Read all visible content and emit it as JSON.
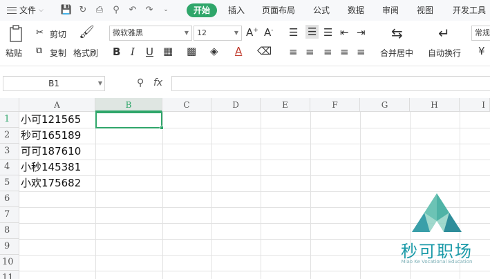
{
  "menubar": {
    "file_label": "文件",
    "tabs": [
      {
        "label": "开始",
        "active": true
      },
      {
        "label": "插入"
      },
      {
        "label": "页面布局"
      },
      {
        "label": "公式"
      },
      {
        "label": "数据"
      },
      {
        "label": "审阅"
      },
      {
        "label": "视图"
      },
      {
        "label": "开发工具"
      }
    ]
  },
  "ribbon": {
    "paste": "粘贴",
    "cut": "剪切",
    "copy": "复制",
    "format_painter": "格式刷",
    "font_name": "微软雅黑",
    "font_size": "12",
    "bold": "B",
    "italic": "I",
    "underline": "U",
    "merge_center": "合并居中",
    "wrap_text": "自动换行",
    "number_format": "常规",
    "currency": "¥"
  },
  "formulabar": {
    "cell_ref": "B1",
    "fx": "fx"
  },
  "sheet": {
    "columns": [
      "A",
      "B",
      "C",
      "D",
      "E",
      "F",
      "G",
      "H",
      "I"
    ],
    "rows": [
      "1",
      "2",
      "3",
      "4",
      "5",
      "6",
      "7",
      "8",
      "9",
      "10",
      "11"
    ],
    "selected_column": "B",
    "selected_row": "1",
    "cells_a": [
      "小可121565",
      "秒可165189",
      "可可187610",
      "小秒145381",
      "小欢175682"
    ]
  },
  "watermark": {
    "name": "秒可职场",
    "sub": "Miao Ke Vocational Education"
  },
  "colors": {
    "accent": "#2fa66a",
    "watermark": "#1a9aa8"
  }
}
